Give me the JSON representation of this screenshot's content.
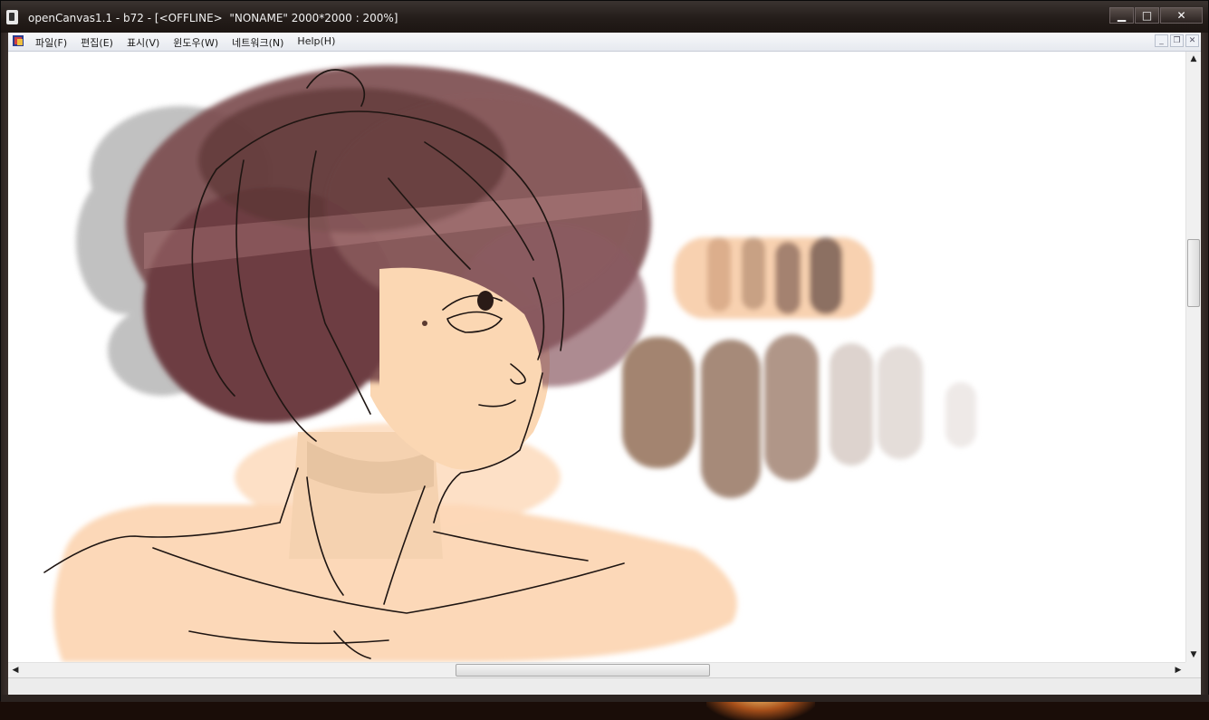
{
  "window": {
    "title": "openCanvas1.1 - b72 - [<OFFLINE>  \"NONAME\" 2000*2000 : 200%]",
    "buttons": {
      "minimize": "▁",
      "maximize": "□",
      "close": "✕"
    }
  },
  "menubar": {
    "items": [
      "파일(F)",
      "편집(E)",
      "표시(V)",
      "윈도우(W)",
      "네트워크(N)",
      "Help(H)"
    ],
    "mdi_buttons": {
      "minimize": "_",
      "restore": "❐",
      "close": "✕"
    }
  },
  "canvas": {
    "content": "digital painting",
    "colors": {
      "hair": "#6e3f43",
      "skin": "#fcd7b6",
      "swatch_dark": "#a08473",
      "swatch_light": "#d9d0cb"
    }
  },
  "scrollbars": {
    "up": "▲",
    "down": "▼",
    "left": "◀",
    "right": "▶"
  }
}
